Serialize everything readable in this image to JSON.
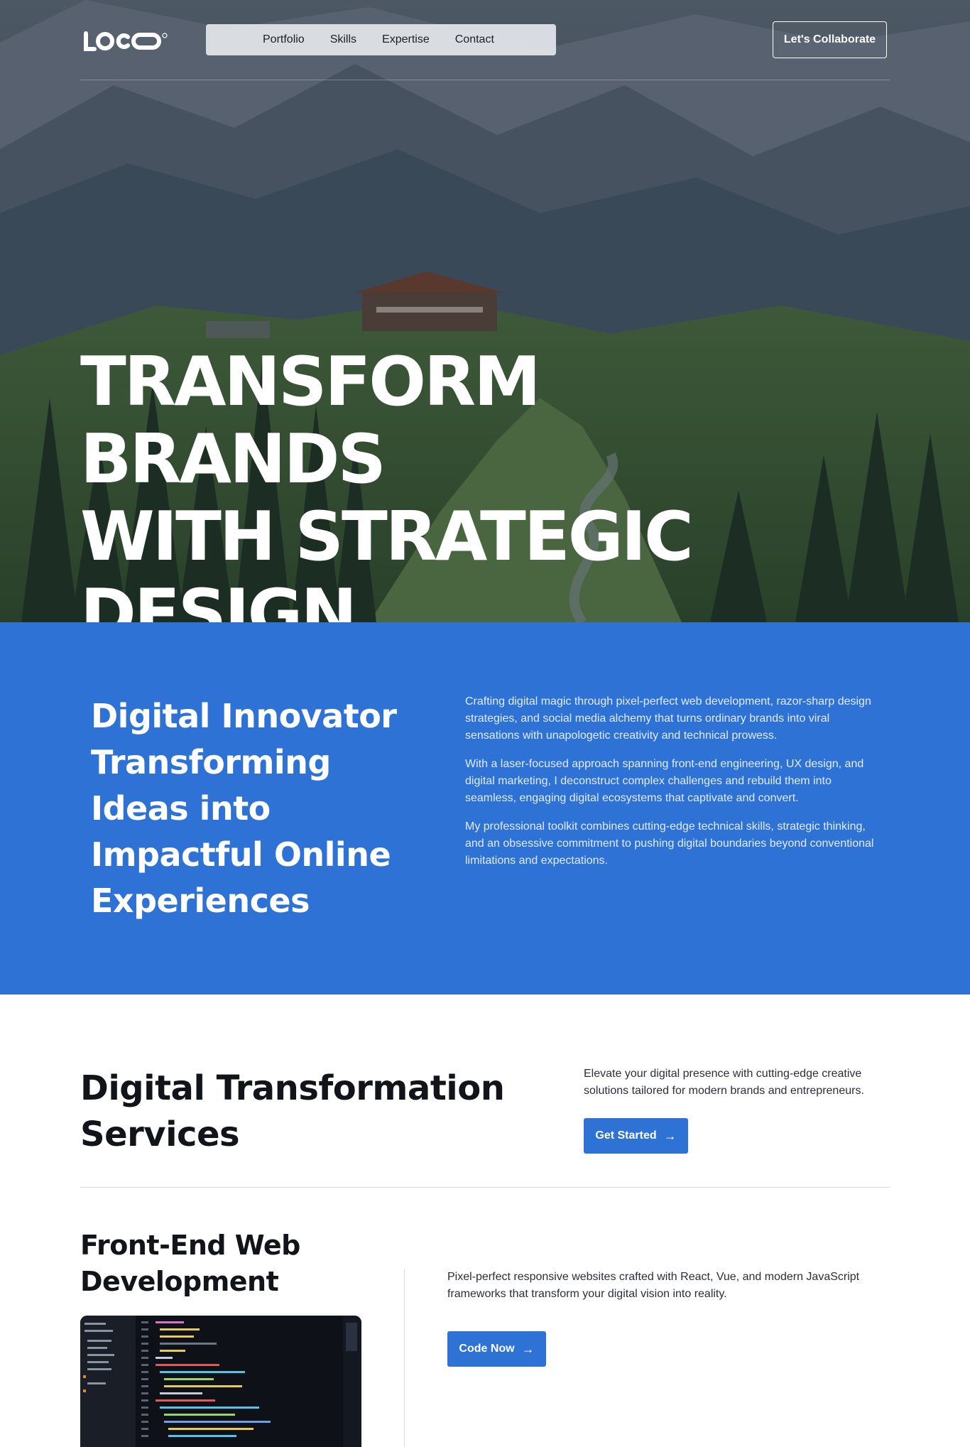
{
  "header": {
    "logo_text": "LOGO",
    "nav": [
      "Portfolio",
      "Skills",
      "Expertise",
      "Contact"
    ],
    "cta_label": "Let's Collaborate"
  },
  "hero": {
    "title_lines": [
      "TRANSFORM BRANDS",
      "WITH STRATEGIC",
      "DESIGN"
    ]
  },
  "about": {
    "title": "Digital Innovator Transforming Ideas into Impactful Online Experiences",
    "paragraphs": [
      "Crafting digital magic through pixel-perfect web development, razor-sharp design strategies, and social media alchemy that turns ordinary brands into viral sensations with unapologetic creativity and technical prowess.",
      "With a laser-focused approach spanning front-end engineering, UX design, and digital marketing, I deconstruct complex challenges and rebuild them into seamless, engaging digital ecosystems that captivate and convert.",
      "My professional toolkit combines cutting-edge technical skills, strategic thinking, and an obsessive commitment to pushing digital boundaries beyond conventional limitations and expectations."
    ],
    "background_color": "#2d72d4"
  },
  "services": {
    "title": "Digital Transformation Services",
    "intro": "Elevate your digital presence with cutting-edge creative solutions tailored for modern brands and entrepreneurs.",
    "button_label": "Get Started",
    "items": [
      {
        "title": "Front-End Web Development",
        "description": "Pixel-perfect responsive websites crafted with React, Vue, and modern JavaScript frameworks that transform your digital vision into reality.",
        "button_label": "Code Now"
      }
    ]
  },
  "icons": {
    "arrow": "arrow-right-icon"
  },
  "colors": {
    "accent": "#2d72d4",
    "text_dark": "#111418",
    "divider": "#d7dbe0"
  }
}
